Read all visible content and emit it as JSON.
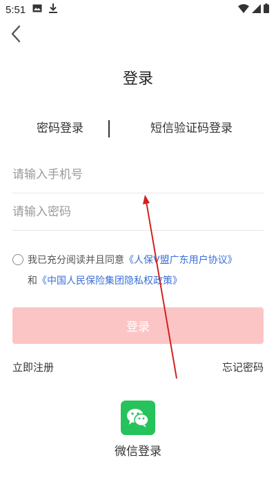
{
  "status_bar": {
    "time": "5:51",
    "left_icons": [
      "gallery-icon",
      "download-icon"
    ],
    "right_icons": [
      "wifi-icon",
      "signal-icon",
      "battery-icon"
    ]
  },
  "header": {
    "back_icon": "back-arrow-icon",
    "title": "登录"
  },
  "tabs": [
    {
      "label": "密码登录"
    },
    {
      "label": "短信验证码登录"
    }
  ],
  "form": {
    "phone_placeholder": "请输入手机号",
    "phone_value": "",
    "password_placeholder": "请输入密码",
    "password_value": ""
  },
  "agreement": {
    "prefix": "我已充分阅读并且同意",
    "user_agreement": "《人保V盟广东用户协议》",
    "conjunction": "和",
    "privacy_policy": "《中国人民保险集团隐私权政策》"
  },
  "login_button": "登录",
  "links": {
    "register": "立即注册",
    "forgot": "忘记密码"
  },
  "wechat": {
    "icon": "wechat-icon",
    "label": "微信登录"
  },
  "colors": {
    "login_button_bg": "#fcc5c5",
    "link": "#3a6fd8",
    "wechat_green": "#26c25c",
    "annotation_arrow": "#d11f1f"
  }
}
